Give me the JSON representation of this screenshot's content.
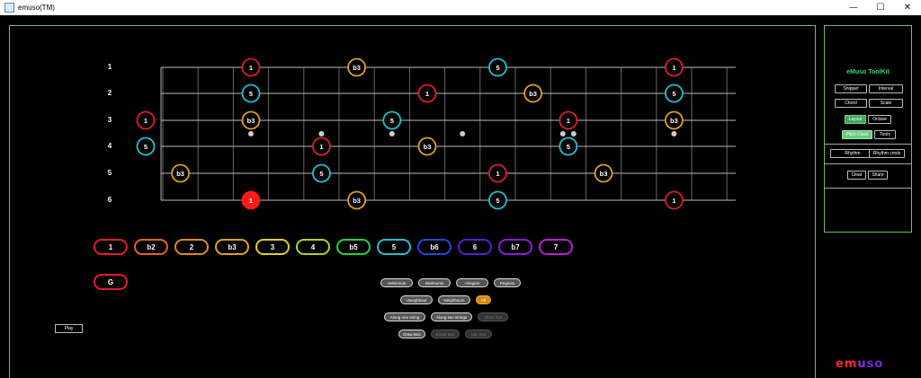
{
  "window": {
    "title": "emuso(TM)",
    "minimize": "—",
    "maximize": "☐",
    "close": "✕"
  },
  "strings": [
    "1",
    "2",
    "3",
    "4",
    "5",
    "6"
  ],
  "notes": [
    {
      "s": 1,
      "fret": 2,
      "label": "1",
      "color": "#e01e2b",
      "filled": false
    },
    {
      "s": 1,
      "fret": 5,
      "label": "b3",
      "color": "#e0a21a",
      "filled": false
    },
    {
      "s": 1,
      "fret": 9,
      "label": "5",
      "color": "#19c4d4",
      "filled": false
    },
    {
      "s": 1,
      "fret": 14,
      "label": "1",
      "color": "#e01e2b",
      "filled": false
    },
    {
      "s": 2,
      "fret": 2,
      "label": "5",
      "color": "#19c4d4",
      "filled": false
    },
    {
      "s": 2,
      "fret": 7,
      "label": "1",
      "color": "#e01e2b",
      "filled": false
    },
    {
      "s": 2,
      "fret": 10,
      "label": "b3",
      "color": "#e0a21a",
      "filled": false
    },
    {
      "s": 2,
      "fret": 14,
      "label": "5",
      "color": "#19c4d4",
      "filled": false
    },
    {
      "s": 3,
      "fret": -1,
      "label": "1",
      "color": "#e01e2b",
      "filled": false
    },
    {
      "s": 3,
      "fret": 2,
      "label": "b3",
      "color": "#e0a21a",
      "filled": false
    },
    {
      "s": 3,
      "fret": 6,
      "label": "5",
      "color": "#19c4d4",
      "filled": false
    },
    {
      "s": 3,
      "fret": 11,
      "label": "1",
      "color": "#e01e2b",
      "filled": false
    },
    {
      "s": 3,
      "fret": 14,
      "label": "b3",
      "color": "#e0a21a",
      "filled": false
    },
    {
      "s": 4,
      "fret": -1,
      "label": "5",
      "color": "#19c4d4",
      "filled": false
    },
    {
      "s": 4,
      "fret": 4,
      "label": "1",
      "color": "#e01e2b",
      "filled": false
    },
    {
      "s": 4,
      "fret": 7,
      "label": "b3",
      "color": "#e0a21a",
      "filled": false
    },
    {
      "s": 4,
      "fret": 11,
      "label": "5",
      "color": "#19c4d4",
      "filled": false
    },
    {
      "s": 5,
      "fret": 0,
      "label": "b3",
      "color": "#e0a21a",
      "filled": false
    },
    {
      "s": 5,
      "fret": 4,
      "label": "5",
      "color": "#19c4d4",
      "filled": false
    },
    {
      "s": 5,
      "fret": 9,
      "label": "1",
      "color": "#e01e2b",
      "filled": false
    },
    {
      "s": 5,
      "fret": 12,
      "label": "b3",
      "color": "#e0a21a",
      "filled": false
    },
    {
      "s": 6,
      "fret": 2,
      "label": "1",
      "color": "#ff1a1a",
      "filled": true
    },
    {
      "s": 6,
      "fret": 5,
      "label": "b3",
      "color": "#e0a21a",
      "filled": false
    },
    {
      "s": 6,
      "fret": 9,
      "label": "5",
      "color": "#19c4d4",
      "filled": false
    },
    {
      "s": 6,
      "fret": 14,
      "label": "1",
      "color": "#e01e2b",
      "filled": false
    }
  ],
  "inlay_frets": [
    2,
    4,
    6,
    8,
    11,
    14
  ],
  "double_inlay_fret": 11,
  "degrees": [
    {
      "label": "1",
      "color": "#e01e2b"
    },
    {
      "label": "b2",
      "color": "#e0671a"
    },
    {
      "label": "2",
      "color": "#e08a1a"
    },
    {
      "label": "b3",
      "color": "#e0a21a"
    },
    {
      "label": "3",
      "color": "#e0d01a"
    },
    {
      "label": "4",
      "color": "#a8d81a"
    },
    {
      "label": "b5",
      "color": "#1ad83a"
    },
    {
      "label": "5",
      "color": "#19c4d4"
    },
    {
      "label": "b6",
      "color": "#1a4ae0"
    },
    {
      "label": "6",
      "color": "#5a1ae0"
    },
    {
      "label": "b7",
      "color": "#8a1ae0"
    },
    {
      "label": "7",
      "color": "#c01ad8"
    }
  ],
  "key_button": {
    "label": "G",
    "color": "#e01e2b"
  },
  "region_pills": [
    [
      {
        "label": "≈Minimum",
        "state": "normal"
      },
      {
        "label": "Minimums",
        "state": "normal"
      },
      {
        "label": "≈Region",
        "state": "normal"
      },
      {
        "label": "Regions",
        "state": "normal"
      }
    ],
    [
      {
        "label": "≈Neighbour",
        "state": "normal"
      },
      {
        "label": "Neighbours",
        "state": "normal"
      },
      {
        "label": "All",
        "state": "active"
      }
    ],
    [
      {
        "label": "Along one string",
        "state": "normal"
      },
      {
        "label": "Along two strings",
        "state": "normal"
      },
      {
        "label": "Three tips",
        "state": "dim"
      }
    ],
    [
      {
        "label": "Draw Box",
        "state": "normal"
      },
      {
        "label": "Break Box",
        "state": "dim"
      },
      {
        "label": "Use Box",
        "state": "dim"
      }
    ]
  ],
  "play_label": "Play",
  "toolkit": {
    "title": "eMuso ToolKit",
    "snippet": "Snippet",
    "interval": "Interval",
    "chord": "Chord",
    "scale": "Scale",
    "layout": "Layout",
    "octave": "Octave",
    "pitch_class": "Pitch Class",
    "tools": "Tools",
    "rhythm": "Rhythm",
    "rhythm_cmds": "Rhythm cmds",
    "clear": "Clear",
    "share": "Share"
  },
  "logo": {
    "e": "e",
    "m": "m",
    "u": "u",
    "s": "s",
    "o": "o"
  }
}
